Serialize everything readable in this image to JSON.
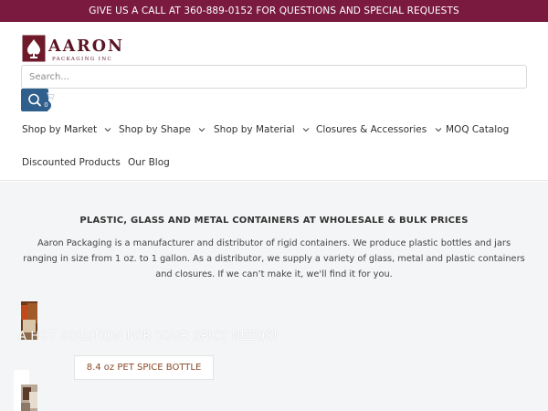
{
  "announcement": "GIVE US A CALL AT 360-889-0152 FOR QUESTIONS AND SPECIAL REQUESTS",
  "logo": {
    "name": "AARON",
    "tagline": "PACKAGING INC"
  },
  "search": {
    "placeholder": "Search...",
    "cart_count": "0"
  },
  "nav": [
    {
      "label": "Shop by Market",
      "has_dropdown": true
    },
    {
      "label": "Shop by Shape",
      "has_dropdown": true
    },
    {
      "label": "Shop by Material",
      "has_dropdown": true
    },
    {
      "label": "Closures & Accessories",
      "has_dropdown": true
    },
    {
      "label": "MOQ Catalog",
      "has_dropdown": false
    },
    {
      "label": "Discounted Products",
      "has_dropdown": false
    },
    {
      "label": "Our Blog",
      "has_dropdown": false
    }
  ],
  "intro": {
    "title": "PLASTIC, GLASS AND METAL CONTAINERS AT WHOLESALE & BULK PRICES",
    "text": "Aaron Packaging is a manufacturer and distributor of rigid containers. We produce plastic bottles and jars ranging in size from 1 oz. to 1 gallon. As a distributor, we supply a variety of glass, metal and plastic containers and closures. If we can’t make it, we'll find it for you."
  },
  "hero": {
    "headline": "A HOT SOLUTION FOR YOUR SPICY NEEDS!",
    "cta_label": "8.4 oz PET SPICE BOTTLE"
  },
  "colors": {
    "announcement_bg": "#7a1a3f",
    "brand": "#5a1424",
    "button_blue": "#2f5f8c"
  }
}
